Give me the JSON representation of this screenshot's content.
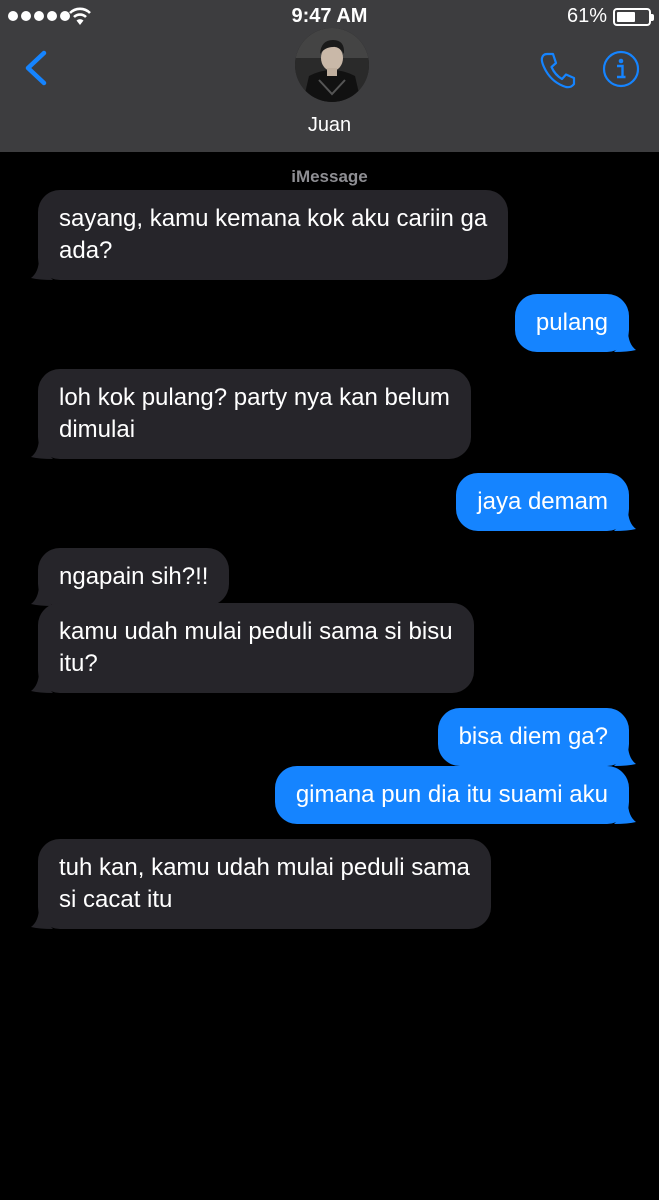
{
  "status": {
    "time": "9:47 AM",
    "battery": "61%",
    "battery_level": 0.61
  },
  "header": {
    "contact_name": "Juan"
  },
  "colors": {
    "accent": "#1584ff",
    "incoming": "#26252a",
    "header": "#3d3d3f"
  },
  "icons": {
    "back": "chevron-left-icon",
    "call": "phone-icon",
    "info": "info-icon"
  },
  "thread": {
    "service_label": "iMessage",
    "messages": [
      {
        "direction": "incoming",
        "lines": [
          "sayang, kamu kemana kok aku cariin ga",
          "ada?"
        ]
      },
      {
        "direction": "outgoing",
        "lines": [
          "pulang"
        ]
      },
      {
        "direction": "incoming",
        "lines": [
          "loh kok pulang? party nya kan belum",
          "dimulai"
        ]
      },
      {
        "direction": "outgoing",
        "lines": [
          "jaya demam"
        ]
      },
      {
        "direction": "incoming",
        "lines": [
          "ngapain sih?!!"
        ]
      },
      {
        "direction": "incoming",
        "lines": [
          "kamu udah mulai peduli sama si bisu",
          "itu?"
        ]
      },
      {
        "direction": "outgoing",
        "lines": [
          "bisa diem ga?"
        ]
      },
      {
        "direction": "outgoing",
        "lines": [
          "gimana pun dia itu suami aku"
        ]
      },
      {
        "direction": "incoming",
        "lines": [
          "tuh kan, kamu udah mulai peduli sama",
          "si cacat itu"
        ]
      }
    ]
  }
}
